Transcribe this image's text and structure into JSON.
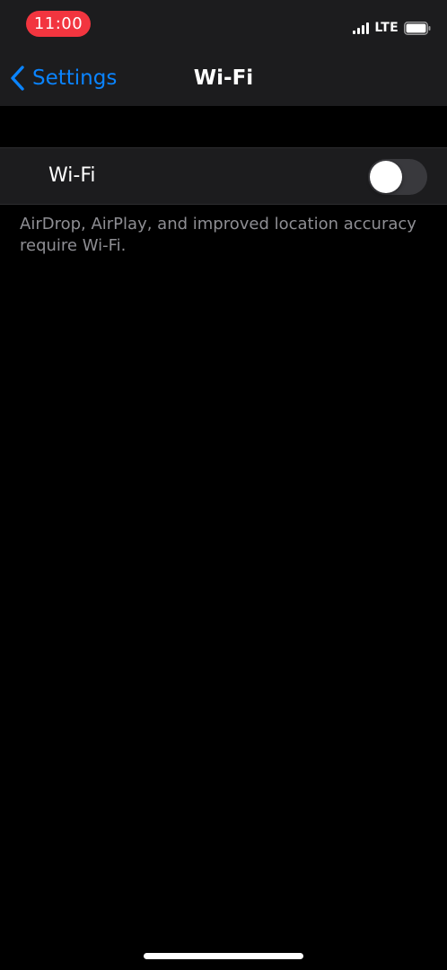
{
  "status_bar": {
    "time": "11:00",
    "network": "LTE",
    "icons": {
      "signal": "cellular-signal-icon",
      "battery": "battery-icon"
    }
  },
  "nav": {
    "back_label": "Settings",
    "title": "Wi-Fi",
    "back_icon": "chevron-left-icon"
  },
  "wifi_row": {
    "label": "Wi-Fi",
    "enabled": false
  },
  "footer_note": "AirDrop, AirPlay, and improved location accuracy require Wi-Fi.",
  "colors": {
    "accent": "#0a84ff",
    "time_pill": "#f2353f",
    "background": "#000000",
    "group_background": "#1c1c1e",
    "toggle_off": "#39393d",
    "secondary_text": "#8e8e93"
  }
}
